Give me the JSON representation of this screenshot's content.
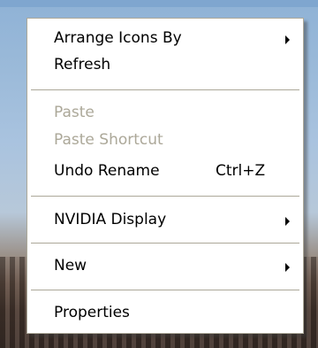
{
  "menu": {
    "items": [
      {
        "label": "Arrange Icons By",
        "submenu": true,
        "disabled": false,
        "shortcut": ""
      },
      {
        "label": "Refresh",
        "submenu": false,
        "disabled": false,
        "shortcut": ""
      },
      {
        "label": "Paste",
        "submenu": false,
        "disabled": true,
        "shortcut": ""
      },
      {
        "label": "Paste Shortcut",
        "submenu": false,
        "disabled": true,
        "shortcut": ""
      },
      {
        "label": "Undo Rename",
        "submenu": false,
        "disabled": false,
        "shortcut": "Ctrl+Z"
      },
      {
        "label": "NVIDIA Display",
        "submenu": true,
        "disabled": false,
        "shortcut": ""
      },
      {
        "label": "New",
        "submenu": true,
        "disabled": false,
        "shortcut": ""
      },
      {
        "label": "Properties",
        "submenu": false,
        "disabled": false,
        "shortcut": ""
      }
    ]
  },
  "colors": {
    "menu_background": "#ffffff",
    "disabled_text": "#aca899",
    "separator": "#aca899"
  }
}
